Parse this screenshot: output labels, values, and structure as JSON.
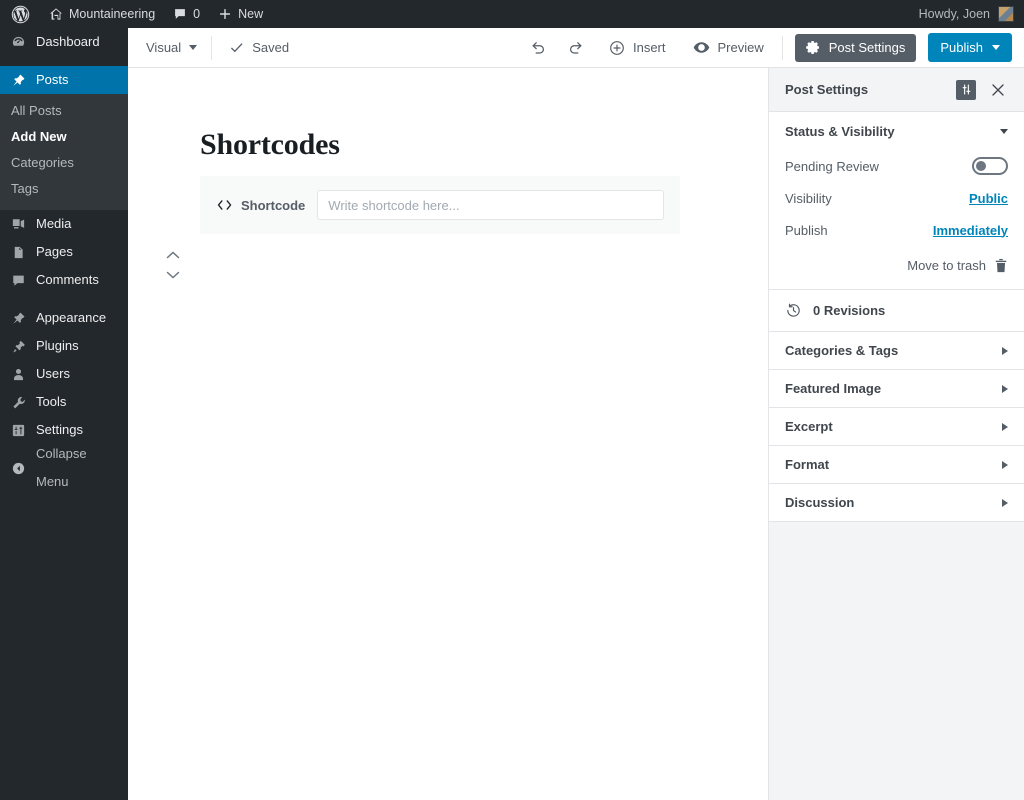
{
  "adminbar": {
    "logo_icon": "wordpress-logo-icon",
    "site_name": "Mountaineering",
    "site_icon": "home-icon",
    "comments_icon": "comment-bubble-icon",
    "comments_count": "0",
    "new_icon": "plus-icon",
    "new_label": "New",
    "howdy": "Howdy, Joen",
    "avatar_icon": "user-avatar"
  },
  "adminmenu": {
    "items": [
      {
        "label": "Dashboard",
        "icon": "dashboard-icon",
        "current": false
      },
      {
        "label": "Posts",
        "icon": "pin-icon",
        "current": true
      },
      {
        "label": "Media",
        "icon": "media-icon",
        "current": false
      },
      {
        "label": "Pages",
        "icon": "page-icon",
        "current": false
      },
      {
        "label": "Comments",
        "icon": "comment-bubble-icon",
        "current": false
      },
      {
        "label": "Appearance",
        "icon": "paintbrush-icon",
        "current": false
      },
      {
        "label": "Plugins",
        "icon": "plug-icon",
        "current": false
      },
      {
        "label": "Users",
        "icon": "user-icon",
        "current": false
      },
      {
        "label": "Tools",
        "icon": "wrench-icon",
        "current": false
      },
      {
        "label": "Settings",
        "icon": "settings-sliders-icon",
        "current": false
      }
    ],
    "submenu": [
      {
        "label": "All Posts",
        "current": false
      },
      {
        "label": "Add New",
        "current": true
      },
      {
        "label": "Categories",
        "current": false
      },
      {
        "label": "Tags",
        "current": false
      }
    ],
    "collapse": {
      "label": "Collapse Menu",
      "icon": "collapse-arrow-icon"
    },
    "active_color": "#0073aa",
    "background": "#23282d",
    "submenu_background": "#32373c"
  },
  "editor_toolbar": {
    "mode_label": "Visual",
    "mode_icon": "chevron-down-icon",
    "saved_label": "Saved",
    "saved_icon": "checkmark-icon",
    "undo_icon": "undo-icon",
    "redo_icon": "redo-icon",
    "insert_label": "Insert",
    "insert_icon": "plus-circle-icon",
    "preview_label": "Preview",
    "preview_icon": "eye-icon",
    "post_settings_label": "Post Settings",
    "post_settings_icon": "gear-icon",
    "publish_label": "Publish",
    "publish_caret_icon": "caret-down-icon",
    "publish_color": "#0085ba"
  },
  "editor": {
    "post_title": "Shortcodes",
    "block": {
      "label": "Shortcode",
      "icon": "shortcode-brackets-icon",
      "input_value": "",
      "input_placeholder": "Write shortcode here...",
      "move_up_icon": "chevron-up-icon",
      "move_down_icon": "chevron-down-icon"
    }
  },
  "sidebar": {
    "title": "Post Settings",
    "sliders_icon": "sliders-icon",
    "close_icon": "close-icon",
    "status_visibility": {
      "title": "Status & Visibility",
      "collapse_icon": "caret-down-icon",
      "pending_review_label": "Pending Review",
      "pending_review_on": false,
      "visibility_label": "Visibility",
      "visibility_value": "Public",
      "publish_label": "Publish",
      "publish_value": "Immediately",
      "trash_label": "Move to trash",
      "trash_icon": "trash-icon"
    },
    "revisions": {
      "label": "0 Revisions",
      "icon": "revisions-clock-icon"
    },
    "panels": [
      {
        "label": "Categories & Tags",
        "expand_icon": "arrow-right-icon"
      },
      {
        "label": "Featured Image",
        "expand_icon": "arrow-right-icon"
      },
      {
        "label": "Excerpt",
        "expand_icon": "arrow-right-icon"
      },
      {
        "label": "Format",
        "expand_icon": "arrow-right-icon"
      },
      {
        "label": "Discussion",
        "expand_icon": "arrow-right-icon"
      }
    ],
    "link_color": "#0085ba"
  }
}
